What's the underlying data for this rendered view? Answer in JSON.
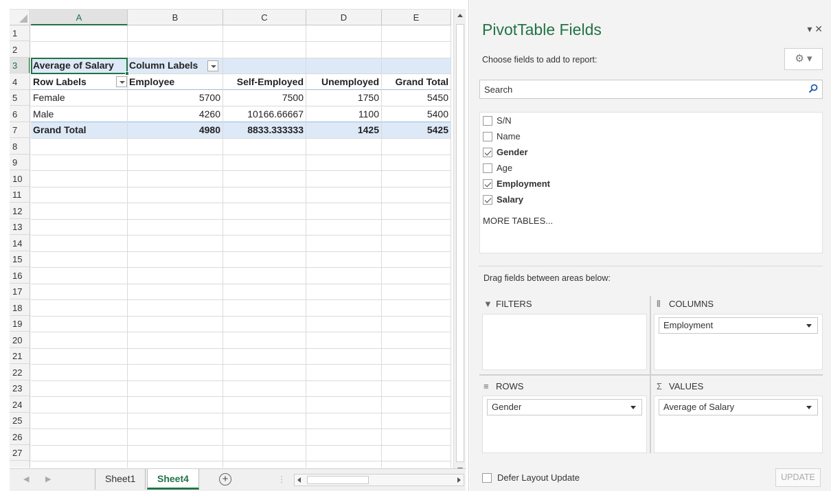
{
  "sheet": {
    "columns": [
      "A",
      "B",
      "C",
      "D",
      "E"
    ],
    "rows": [
      "1",
      "2",
      "3",
      "4",
      "5",
      "6",
      "7",
      "8",
      "9",
      "10",
      "11",
      "12",
      "13",
      "14",
      "15",
      "16",
      "17",
      "18",
      "19",
      "20",
      "21",
      "22",
      "23",
      "24",
      "25",
      "26",
      "27"
    ],
    "pivot": {
      "r3": {
        "a": "Average of Salary",
        "b": "Column Labels"
      },
      "r4": {
        "a": "Row Labels",
        "b": "Employee",
        "c": "Self-Employed",
        "d": "Unemployed",
        "e": "Grand Total"
      },
      "r5": {
        "a": "Female",
        "b": "5700",
        "c": "7500",
        "d": "1750",
        "e": "5450"
      },
      "r6": {
        "a": "Male",
        "b": "4260",
        "c": "10166.66667",
        "d": "1100",
        "e": "5400"
      },
      "r7": {
        "a": "Grand Total",
        "b": "4980",
        "c": "8833.333333",
        "d": "1425",
        "e": "5425"
      }
    },
    "tabs": {
      "sheet1": "Sheet1",
      "sheet4": "Sheet4",
      "add": "+"
    }
  },
  "pane": {
    "title": "PivotTable Fields",
    "controls": "▾ ✕",
    "choose_label": "Choose fields to add to report:",
    "gear": "⚙ ▾",
    "search_placeholder": "Search",
    "fields": [
      {
        "label": "S/N",
        "checked": false
      },
      {
        "label": "Name",
        "checked": false
      },
      {
        "label": "Gender",
        "checked": true
      },
      {
        "label": "Age",
        "checked": false
      },
      {
        "label": "Employment",
        "checked": true
      },
      {
        "label": "Salary",
        "checked": true
      }
    ],
    "more_tables": "MORE TABLES...",
    "drag_label": "Drag fields between areas below:",
    "areas": {
      "filters": {
        "icon": "▼",
        "label": "FILTERS"
      },
      "columns": {
        "icon": "⦀",
        "label": "COLUMNS",
        "field": "Employment"
      },
      "rows": {
        "icon": "≡",
        "label": "ROWS",
        "field": "Gender"
      },
      "values": {
        "icon": "Σ",
        "label": "VALUES",
        "field": "Average of Salary"
      }
    },
    "defer_label": "Defer Layout Update",
    "update_label": "UPDATE"
  },
  "colors": {
    "accent": "#217346",
    "band": "#dde9f7"
  }
}
